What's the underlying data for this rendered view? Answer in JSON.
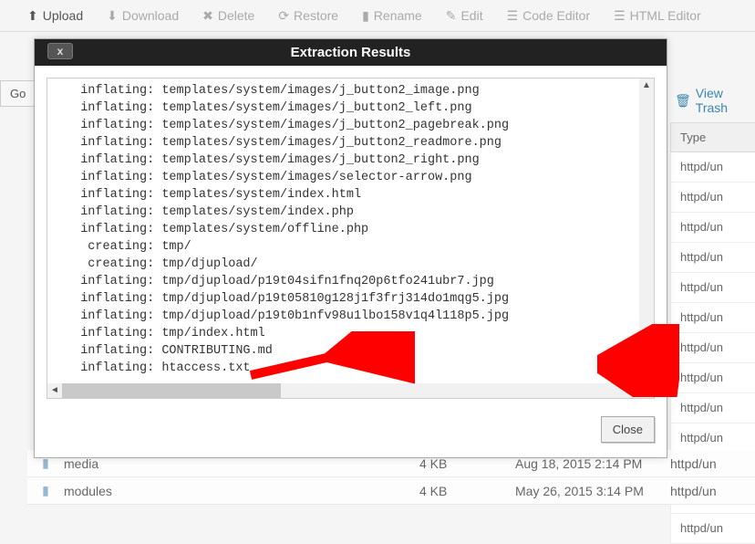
{
  "toolbar": {
    "upload": "Upload",
    "download": "Download",
    "delete": "Delete",
    "restore": "Restore",
    "rename": "Rename",
    "edit": "Edit",
    "code_editor": "Code Editor",
    "html_editor": "HTML Editor"
  },
  "go_label": "Go",
  "view_trash_label": "View Trash",
  "type_header": "Type",
  "type_cells": [
    "httpd/un",
    "httpd/un",
    "httpd/un",
    "httpd/un",
    "httpd/un",
    "httpd/un",
    "httpd/un",
    "httpd/un",
    "httpd/un",
    "httpd/un",
    "httpd/un",
    "httpd/un",
    "httpd/un"
  ],
  "bottom_rows": [
    {
      "name": "media",
      "size": "4 KB",
      "date": "Aug 18, 2015 2:14 PM",
      "type": "httpd/un"
    },
    {
      "name": "modules",
      "size": "4 KB",
      "date": "May 26, 2015 3:14 PM",
      "type": "httpd/un"
    }
  ],
  "modal": {
    "title": "Extraction Results",
    "close_x": "x",
    "close_btn": "Close",
    "lines": [
      "  inflating: templates/system/images/j_button2_image.png",
      "  inflating: templates/system/images/j_button2_left.png",
      "  inflating: templates/system/images/j_button2_pagebreak.png",
      "  inflating: templates/system/images/j_button2_readmore.png",
      "  inflating: templates/system/images/j_button2_right.png",
      "  inflating: templates/system/images/selector-arrow.png",
      "  inflating: templates/system/index.html",
      "  inflating: templates/system/index.php",
      "  inflating: templates/system/offline.php",
      "   creating: tmp/",
      "   creating: tmp/djupload/",
      "  inflating: tmp/djupload/p19t04sifn1fnq20p6tfo241ubr7.jpg",
      "  inflating: tmp/djupload/p19t05810g128j1f3frj314do1mqg5.jpg",
      "  inflating: tmp/djupload/p19t0b1nfv98u1lbo158v1q4l118p5.jpg",
      "  inflating: tmp/index.html",
      "  inflating: CONTRIBUTING.md",
      "  inflating: htaccess.txt"
    ]
  }
}
